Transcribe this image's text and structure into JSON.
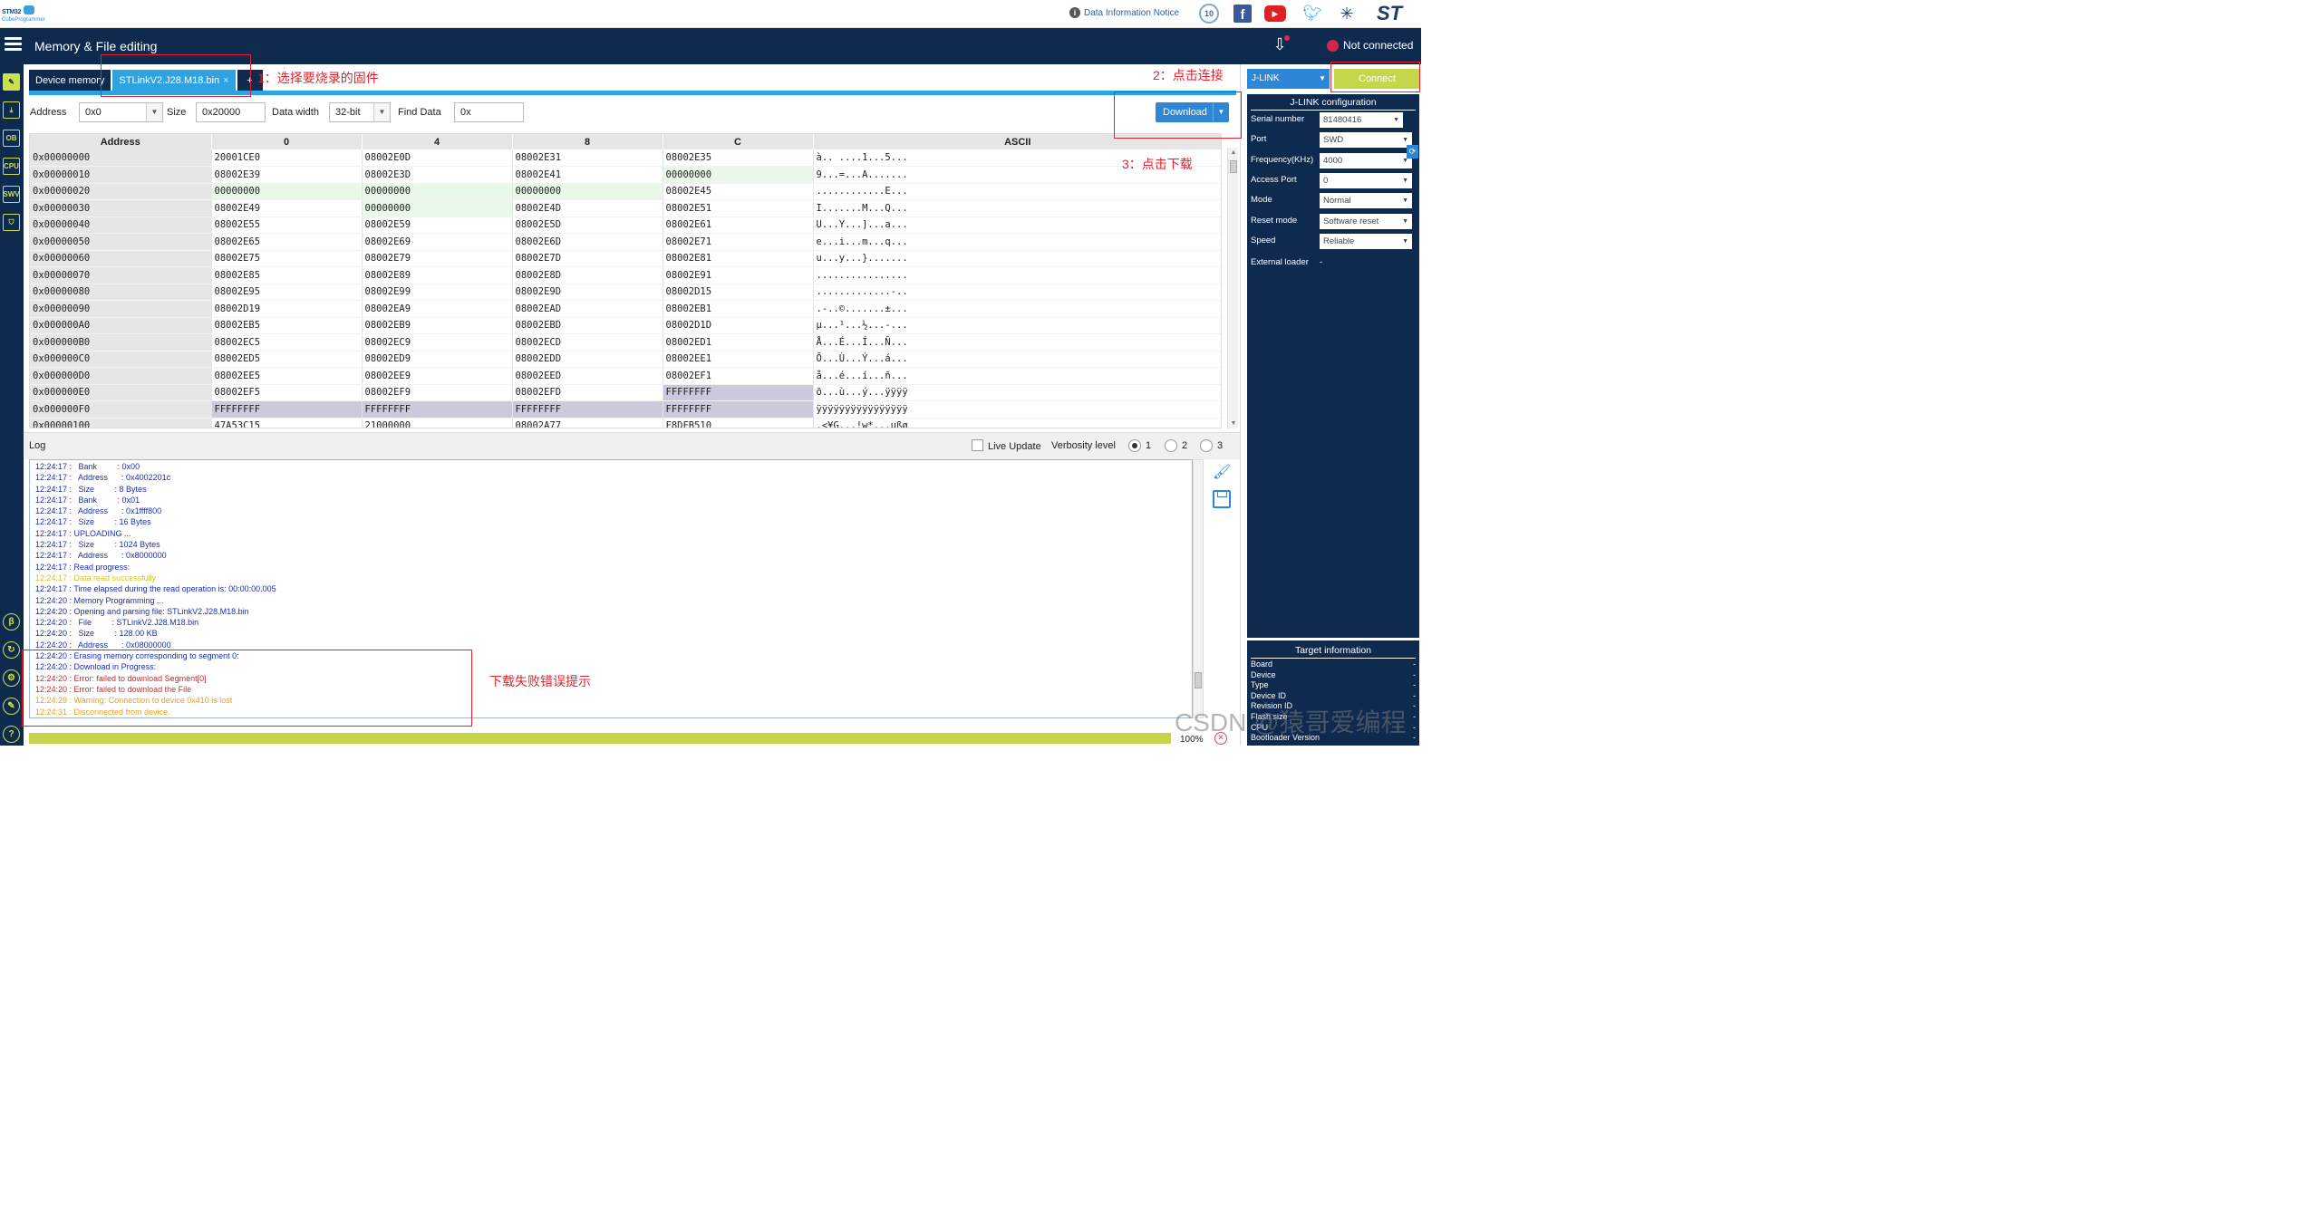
{
  "app": {
    "logo_line1": "STM32",
    "logo_line2": "CubeProgrammer",
    "info_link": "Data Information Notice",
    "badge_10": "10",
    "page_title": "Memory & File editing",
    "connection_status": "Not connected"
  },
  "tabs": {
    "device_memory": "Device memory",
    "file_tab": "STLinkV2.J28.M18.bin",
    "close_glyph": "×",
    "add": "+"
  },
  "controls": {
    "address_label": "Address",
    "address_value": "0x0",
    "size_label": "Size",
    "size_value": "0x20000",
    "data_width_label": "Data width",
    "data_width_value": "32-bit",
    "find_label": "Find Data",
    "find_value": "0x",
    "download_button": "Download"
  },
  "grid": {
    "headers": [
      "Address",
      "0",
      "4",
      "8",
      "C",
      "ASCII"
    ],
    "rows": [
      [
        "0x00000000",
        "20001CE0",
        "08002E0D",
        "08002E31",
        "08002E35",
        "à.. ....1...5..."
      ],
      [
        "0x00000010",
        "08002E39",
        "08002E3D",
        "08002E41",
        "00000000",
        "9...=...A......."
      ],
      [
        "0x00000020",
        "00000000",
        "00000000",
        "00000000",
        "08002E45",
        "............E..."
      ],
      [
        "0x00000030",
        "08002E49",
        "00000000",
        "08002E4D",
        "08002E51",
        "I.......M...Q..."
      ],
      [
        "0x00000040",
        "08002E55",
        "08002E59",
        "08002E5D",
        "08002E61",
        "U...Y...]...a..."
      ],
      [
        "0x00000050",
        "08002E65",
        "08002E69",
        "08002E6D",
        "08002E71",
        "e...i...m...q..."
      ],
      [
        "0x00000060",
        "08002E75",
        "08002E79",
        "08002E7D",
        "08002E81",
        "u...y...}......."
      ],
      [
        "0x00000070",
        "08002E85",
        "08002E89",
        "08002E8D",
        "08002E91",
        "................"
      ],
      [
        "0x00000080",
        "08002E95",
        "08002E99",
        "08002E9D",
        "08002D15",
        ".............-.."
      ],
      [
        "0x00000090",
        "08002D19",
        "08002EA9",
        "08002EAD",
        "08002EB1",
        ".-..©.......±..."
      ],
      [
        "0x000000A0",
        "08002EB5",
        "08002EB9",
        "08002EBD",
        "08002D1D",
        "µ...¹...½...-..."
      ],
      [
        "0x000000B0",
        "08002EC5",
        "08002EC9",
        "08002ECD",
        "08002ED1",
        "Å...É...Í...Ñ..."
      ],
      [
        "0x000000C0",
        "08002ED5",
        "08002ED9",
        "08002EDD",
        "08002EE1",
        "Õ...Ù...Ý...á..."
      ],
      [
        "0x000000D0",
        "08002EE5",
        "08002EE9",
        "08002EED",
        "08002EF1",
        "å...é...í...ñ..."
      ],
      [
        "0x000000E0",
        "08002EF5",
        "08002EF9",
        "08002EFD",
        "FFFFFFFF",
        "õ...ù...ý...ÿÿÿÿ"
      ],
      [
        "0x000000F0",
        "FFFFFFFF",
        "FFFFFFFF",
        "FFFFFFFF",
        "FFFFFFFF",
        "ÿÿÿÿÿÿÿÿÿÿÿÿÿÿÿÿ"
      ],
      [
        "0x00000100",
        "47A53C15",
        "21000000",
        "08002A77",
        "F8DFB510",
        ".<¥G...!w*...µßø"
      ]
    ]
  },
  "log": {
    "title": "Log",
    "live_update": "Live Update",
    "verbosity_label": "Verbosity level",
    "levels": [
      "1",
      "2",
      "3"
    ],
    "lines": [
      {
        "t": "12:24:17 :   Bank         : 0x00",
        "k": "info"
      },
      {
        "t": "12:24:17 :   Address      : 0x4002201c",
        "k": "info"
      },
      {
        "t": "12:24:17 :   Size         : 8 Bytes",
        "k": "info"
      },
      {
        "t": "12:24:17 :   Bank         : 0x01",
        "k": "info"
      },
      {
        "t": "12:24:17 :   Address      : 0x1ffff800",
        "k": "info"
      },
      {
        "t": "12:24:17 :   Size         : 16 Bytes",
        "k": "info"
      },
      {
        "t": "12:24:17 : UPLOADING ...",
        "k": "info"
      },
      {
        "t": "12:24:17 :   Size         : 1024 Bytes",
        "k": "info"
      },
      {
        "t": "12:24:17 :   Address      : 0x8000000",
        "k": "info"
      },
      {
        "t": "12:24:17 : Read progress:",
        "k": "info"
      },
      {
        "t": "12:24:17 : Data read successfully",
        "k": "ok"
      },
      {
        "t": "12:24:17 : Time elapsed during the read operation is: 00:00:00.005",
        "k": "info"
      },
      {
        "t": "12:24:20 : Memory Programming ...",
        "k": "info"
      },
      {
        "t": "12:24:20 : Opening and parsing file: STLinkV2.J28.M18.bin",
        "k": "info"
      },
      {
        "t": "12:24:20 :   File         : STLinkV2.J28.M18.bin",
        "k": "info"
      },
      {
        "t": "12:24:20 :   Size         : 128.00 KB",
        "k": "info"
      },
      {
        "t": "12:24:20 :   Address      : 0x08000000",
        "k": "info"
      },
      {
        "t": "12:24:20 : Erasing memory corresponding to segment 0:",
        "k": "info"
      },
      {
        "t": "12:24:20 : Download in Progress:",
        "k": "info"
      },
      {
        "t": "12:24:20 : Error: failed to download Segment[0]",
        "k": "err"
      },
      {
        "t": "12:24:20 : Error: failed to download the File",
        "k": "err"
      },
      {
        "t": "12:24:29 : Warning: Connection to device 0x410 is lost",
        "k": "warn"
      },
      {
        "t": "12:24:31 : Disconnected from device.",
        "k": "warn"
      }
    ]
  },
  "progress": {
    "value": 1.0,
    "label": "100%"
  },
  "probe": {
    "selected": "J-LINK",
    "connect_button": "Connect",
    "config_title": "J-LINK configuration",
    "fields": [
      {
        "label": "Serial number",
        "value": "81480416"
      },
      {
        "label": "Port",
        "value": "SWD"
      },
      {
        "label": "Frequency(KHz)",
        "value": "4000"
      },
      {
        "label": "Access Port",
        "value": "0"
      },
      {
        "label": "Mode",
        "value": "Normal"
      },
      {
        "label": "Reset mode",
        "value": "Software reset"
      },
      {
        "label": "Speed",
        "value": "Reliable"
      }
    ],
    "external_loader_label": "External loader",
    "external_loader_value": "-"
  },
  "target": {
    "title": "Target information",
    "rows": [
      {
        "label": "Board",
        "value": "-"
      },
      {
        "label": "Device",
        "value": "-"
      },
      {
        "label": "Type",
        "value": "-"
      },
      {
        "label": "Device ID",
        "value": "-"
      },
      {
        "label": "Revision ID",
        "value": "-"
      },
      {
        "label": "Flash size",
        "value": "-"
      },
      {
        "label": "CPU",
        "value": "-"
      },
      {
        "label": "Bootloader Version",
        "value": "-"
      }
    ]
  },
  "annotations": {
    "step1": "1：选择要烧录的固件",
    "step2": "2：点击连接",
    "step3": "3：点击下载",
    "error_hint": "下载失败错误提示"
  },
  "watermark": "CSDN @猿哥爱编程",
  "colors": {
    "navy": "#0e2a4e",
    "accent_blue": "#2ea3e4",
    "lime": "#c6d64a",
    "annotation_red": "#e0242f",
    "error_red": "#d12a2a",
    "warning_orange": "#e8a020"
  }
}
